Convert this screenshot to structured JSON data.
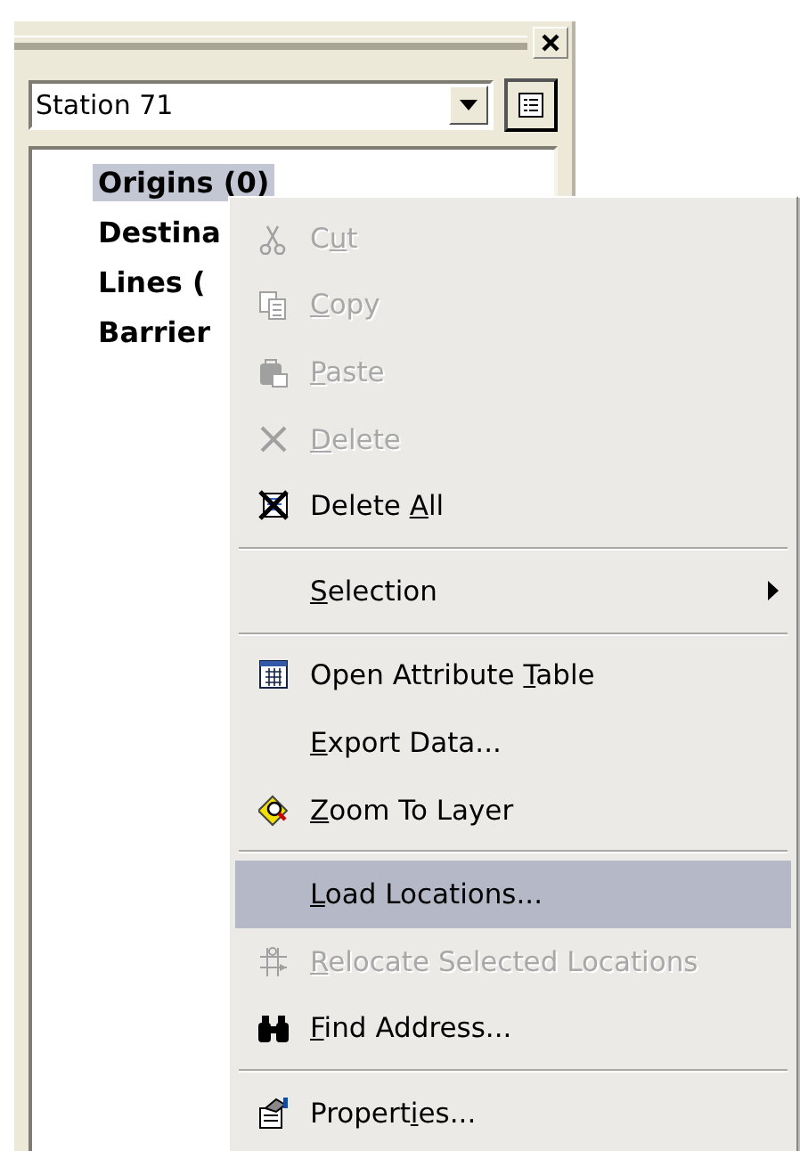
{
  "panel": {
    "combo": {
      "value": "Station 71"
    },
    "tree": [
      {
        "label": "Origins (0)",
        "selected": true
      },
      {
        "label": "Destina",
        "selected": false
      },
      {
        "label": "Lines (",
        "selected": false
      },
      {
        "label": "Barrier",
        "selected": false
      }
    ]
  },
  "context_menu": [
    {
      "kind": "item",
      "label": {
        "before": "C",
        "key": "u",
        "after": "t"
      },
      "disabled": true,
      "selected": false
    },
    {
      "kind": "item",
      "label": {
        "key": "C",
        "after": "opy"
      },
      "disabled": true,
      "selected": false
    },
    {
      "kind": "item",
      "label": {
        "key": "P",
        "after": "aste"
      },
      "disabled": true,
      "selected": false
    },
    {
      "kind": "item",
      "label": {
        "key": "D",
        "after": "elete"
      },
      "disabled": true,
      "selected": false
    },
    {
      "kind": "item",
      "label": {
        "before": "Delete ",
        "key": "A",
        "after": "ll"
      },
      "disabled": false,
      "selected": false
    },
    {
      "kind": "separator"
    },
    {
      "kind": "submenu",
      "label": {
        "key": "S",
        "after": "election"
      },
      "disabled": false,
      "selected": false
    },
    {
      "kind": "separator"
    },
    {
      "kind": "item",
      "label": {
        "before": "Open Attribute ",
        "key": "T",
        "after": "able"
      },
      "disabled": false,
      "selected": false
    },
    {
      "kind": "item",
      "label": {
        "key": "E",
        "after": "xport Data..."
      },
      "disabled": false,
      "selected": false
    },
    {
      "kind": "item",
      "label": {
        "key": "Z",
        "after": "oom To Layer"
      },
      "disabled": false,
      "selected": false
    },
    {
      "kind": "separator"
    },
    {
      "kind": "item",
      "label": {
        "key": "L",
        "after": "oad Locations..."
      },
      "disabled": false,
      "selected": true
    },
    {
      "kind": "item",
      "label": {
        "key": "R",
        "after": "elocate Selected Locations"
      },
      "disabled": true,
      "selected": false
    },
    {
      "kind": "item",
      "label": {
        "key": "F",
        "after": "ind Address..."
      },
      "disabled": false,
      "selected": false
    },
    {
      "kind": "separator"
    },
    {
      "kind": "item",
      "label": {
        "before": "Propert",
        "key": "i",
        "after": "es..."
      },
      "disabled": false,
      "selected": false
    }
  ]
}
